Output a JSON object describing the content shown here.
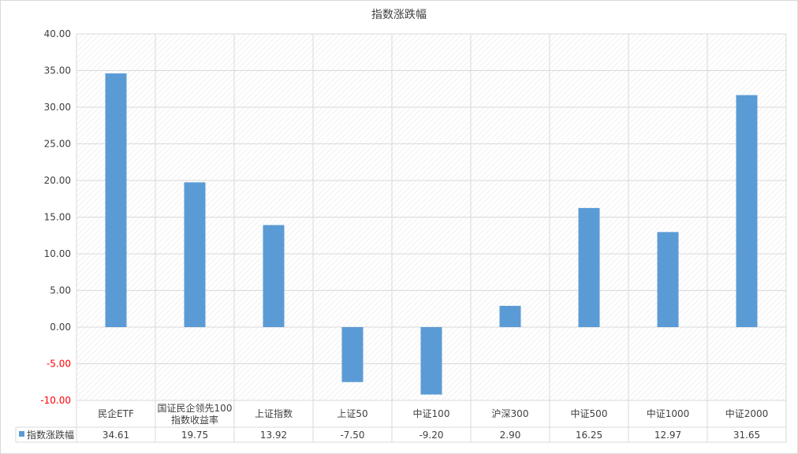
{
  "chart_data": {
    "type": "bar",
    "title": "指数涨跌幅",
    "categories": [
      [
        "民企ETF"
      ],
      [
        "国证民企领先100",
        "指数收益率"
      ],
      [
        "上证指数"
      ],
      [
        "上证50"
      ],
      [
        "中证100"
      ],
      [
        "沪深300"
      ],
      [
        "中证500"
      ],
      [
        "中证1000"
      ],
      [
        "中证2000"
      ]
    ],
    "series": [
      {
        "name": "指数涨跌幅",
        "values": [
          34.61,
          19.75,
          13.92,
          -7.5,
          -9.2,
          2.9,
          16.25,
          12.97,
          31.65
        ],
        "value_labels": [
          "34.61",
          "19.75",
          "13.92",
          "-7.50",
          "-9.20",
          "2.90",
          "16.25",
          "12.97",
          "31.65"
        ],
        "color": "#5b9bd5"
      }
    ],
    "ylim": [
      -10,
      40
    ],
    "yticks": [
      40,
      35,
      30,
      25,
      20,
      15,
      10,
      5,
      0,
      -5,
      -10
    ],
    "ytick_labels": [
      "40.00",
      "35.00",
      "30.00",
      "25.00",
      "20.00",
      "15.00",
      "10.00",
      "5.00",
      "0.00",
      "-5.00",
      "-10.00"
    ],
    "negative_tick_color": "#ff0000",
    "grid": true,
    "legend": "data-table",
    "data_table": true
  }
}
